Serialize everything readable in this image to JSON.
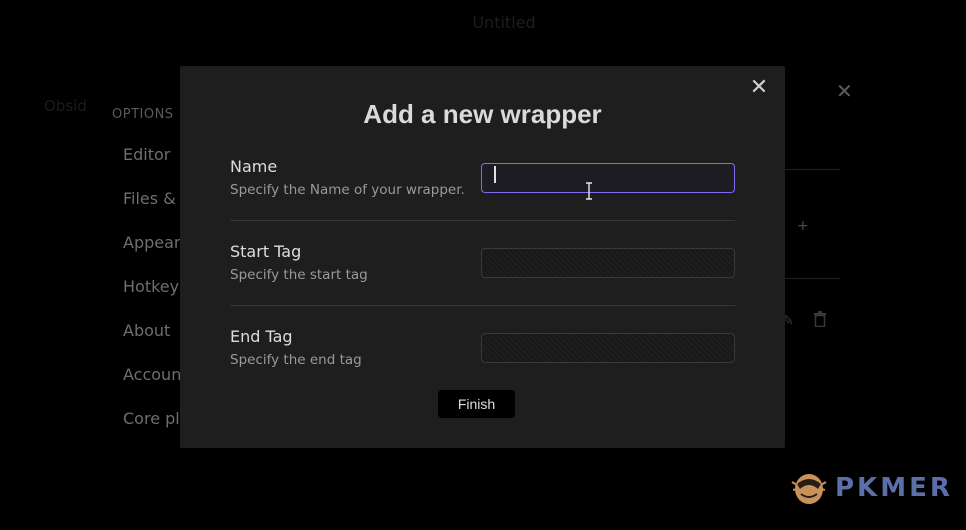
{
  "background": {
    "window_title": "Untitled",
    "app_name": "Obsid",
    "options_header": "OPTIONS",
    "nav_items": [
      "Editor",
      "Files & l",
      "Appeara",
      "Hotkeys",
      "About",
      "Accoun",
      "Core pl"
    ]
  },
  "modal": {
    "title": "Add a new wrapper",
    "close_icon": "close-icon",
    "fields": [
      {
        "name": "Name",
        "description": "Specify the Name of your wrapper.",
        "value": "",
        "placeholder": ""
      },
      {
        "name": "Start Tag",
        "description": "Specify the start tag",
        "value": "",
        "placeholder": ""
      },
      {
        "name": "End Tag",
        "description": "Specify the end tag",
        "value": "",
        "placeholder": ""
      }
    ],
    "finish_label": "Finish"
  },
  "watermark": {
    "text": "PKMER"
  },
  "colors": {
    "accent": "#7f6df2",
    "modal_bg": "#1e1e1e",
    "page_bg": "#000000",
    "watermark": "#5b6fa8"
  }
}
